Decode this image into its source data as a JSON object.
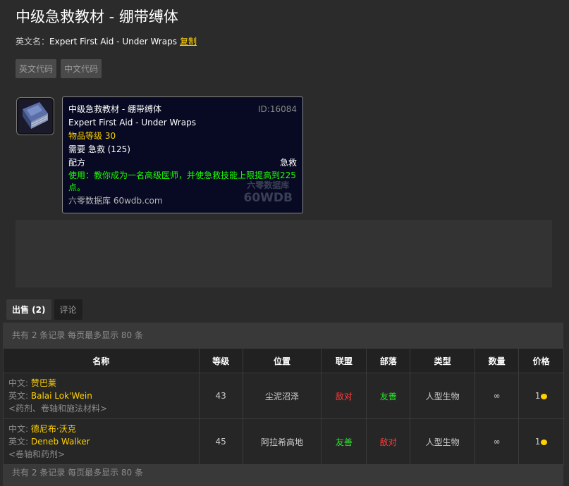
{
  "item": {
    "title": "中级急救教材 - 绷带缚体",
    "ename_label": "英文名：",
    "ename": "Expert First Aid - Under Wraps",
    "copy": "复制",
    "code_en": "英文代码",
    "code_cn": "中文代码",
    "icon": "book-icon"
  },
  "tooltip": {
    "name_cn": "中级急救教材 - 绷带缚体",
    "id": "ID:16084",
    "name_en": "Expert First Aid - Under Wraps",
    "level": "物品等级 30",
    "req": "需要 急救 (125)",
    "type": "配方",
    "type_right": "急救",
    "use": "使用：教你成为一名高级医师，并使急救技能上限提高到225点。",
    "source": "六零数据库 60wdb.com",
    "wm1": "六零数据库",
    "wm2": "60WDB"
  },
  "tabs": [
    {
      "label": "出售 (2)"
    },
    {
      "label": "评论"
    }
  ],
  "panel": {
    "info": "共有 2 条记录 每页最多显示 80 条",
    "columns": [
      "名称",
      "等级",
      "位置",
      "联盟",
      "部落",
      "类型",
      "数量",
      "价格"
    ],
    "rows": [
      {
        "cn_label": "中文:",
        "cn": "赞巴莱",
        "en_label": "英文:",
        "en": "Balai Lok'Wein",
        "sub": "<药剂、卷轴和施法材料>",
        "level": "43",
        "location": "尘泥沼泽",
        "alliance": "敌对",
        "horde": "友善",
        "type": "人型生物",
        "qty": "∞",
        "price": "1"
      },
      {
        "cn_label": "中文:",
        "cn": "德尼布·沃克",
        "en_label": "英文:",
        "en": "Deneb Walker",
        "sub": "<卷轴和药剂>",
        "level": "45",
        "location": "阿拉希高地",
        "alliance": "友善",
        "horde": "敌对",
        "type": "人型生物",
        "qty": "∞",
        "price": "1"
      }
    ]
  },
  "colors": {
    "gold": "#ffd100",
    "hostile": "#ff3c3c",
    "friendly": "#2ee02e"
  }
}
